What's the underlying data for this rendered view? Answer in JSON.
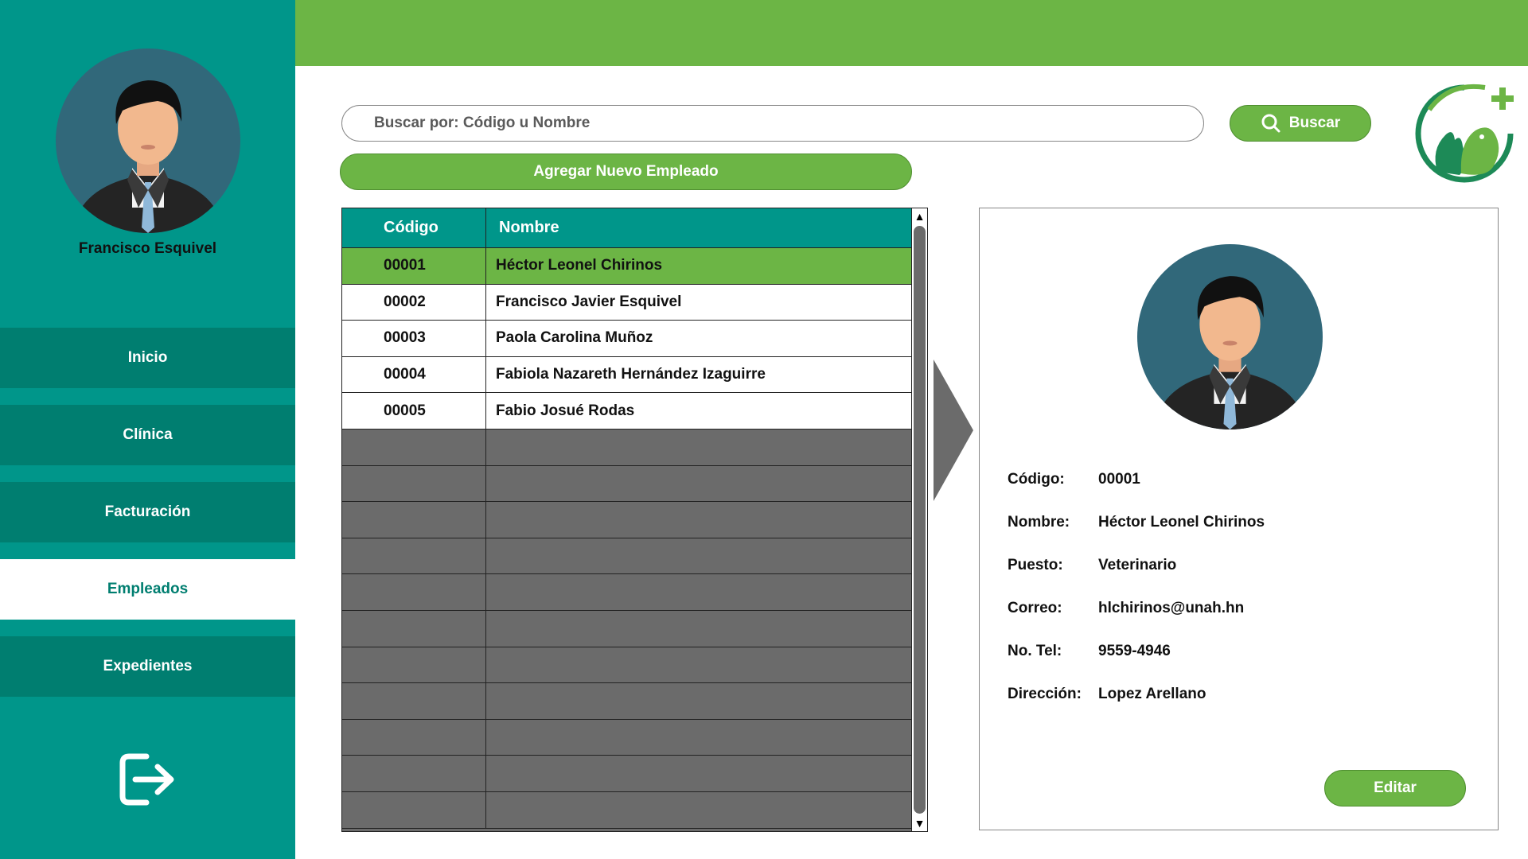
{
  "user": {
    "name": "Francisco Esquivel"
  },
  "nav": {
    "items": [
      {
        "label": "Inicio"
      },
      {
        "label": "Clínica"
      },
      {
        "label": "Facturación"
      },
      {
        "label": "Empleados",
        "active": true
      },
      {
        "label": "Expedientes"
      }
    ]
  },
  "search": {
    "placeholder": "Buscar por: Código u Nombre",
    "button_label": "Buscar"
  },
  "add_button_label": "Agregar Nuevo Empleado",
  "table": {
    "headers": [
      "Código",
      "Nombre"
    ],
    "rows": [
      {
        "code": "00001",
        "name": "Héctor Leonel Chirinos"
      },
      {
        "code": "00002",
        "name": "Francisco Javier Esquivel"
      },
      {
        "code": "00003",
        "name": "Paola Carolina Muñoz"
      },
      {
        "code": "00004",
        "name": "Fabiola Nazareth Hernández Izaguirre"
      },
      {
        "code": "00005",
        "name": "Fabio Josué Rodas"
      }
    ],
    "selected_index": 0
  },
  "detail": {
    "labels": {
      "code": "Código:",
      "name": "Nombre:",
      "position": "Puesto:",
      "email": "Correo:",
      "phone": "No. Tel:",
      "address": "Dirección:"
    },
    "values": {
      "code": "00001",
      "name": "Héctor Leonel Chirinos",
      "position": "Veterinario",
      "email": "hlchirinos@unah.hn",
      "phone": "9559-4946",
      "address": "Lopez Arellano"
    },
    "edit_label": "Editar"
  },
  "icons": {
    "logout": "logout-icon",
    "search": "search-icon",
    "logo": "vet-clinic-logo",
    "scroll_up": "scroll-up-arrow-icon",
    "scroll_down": "scroll-down-arrow-icon"
  },
  "colors": {
    "sidebar": "#00968a",
    "nav_item": "#007e70",
    "green": "#6cb545",
    "avatar_bg": "#31687a",
    "empty_row": "#6b6b6b"
  }
}
